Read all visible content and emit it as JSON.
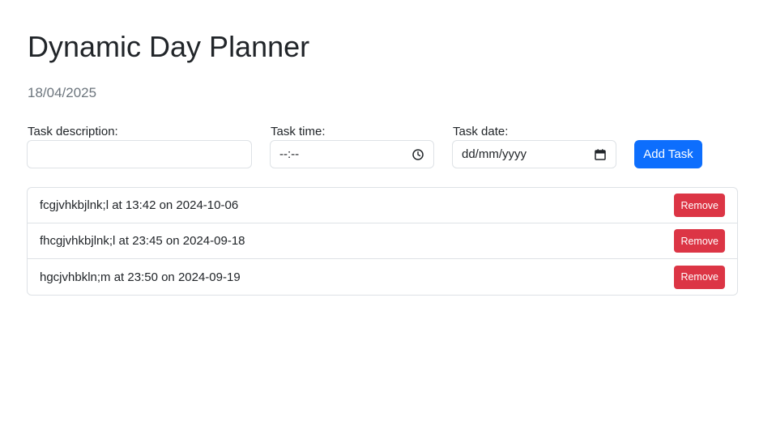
{
  "header": {
    "title": "Dynamic Day Planner",
    "date": "18/04/2025"
  },
  "form": {
    "description_label": "Task description:",
    "description_value": "",
    "time_label": "Task time:",
    "time_placeholder": "--:--",
    "time_icon": "clock-icon",
    "date_label": "Task date:",
    "date_placeholder": "dd/mm/yyyy",
    "date_icon": "calendar-icon",
    "add_button_label": "Add Task"
  },
  "tasks": [
    {
      "text": "fcgjvhkbjlnk;l at 13:42 on 2024-10-06",
      "remove_label": "Remove"
    },
    {
      "text": "fhcgjvhkbjlnk;l at 23:45 on 2024-09-18",
      "remove_label": "Remove"
    },
    {
      "text": "hgcjvhbkln;m at 23:50 on 2024-09-19",
      "remove_label": "Remove"
    }
  ],
  "colors": {
    "primary": "#0d6efd",
    "danger": "#dc3545",
    "border": "#dee2e6",
    "muted": "#6c757d"
  }
}
